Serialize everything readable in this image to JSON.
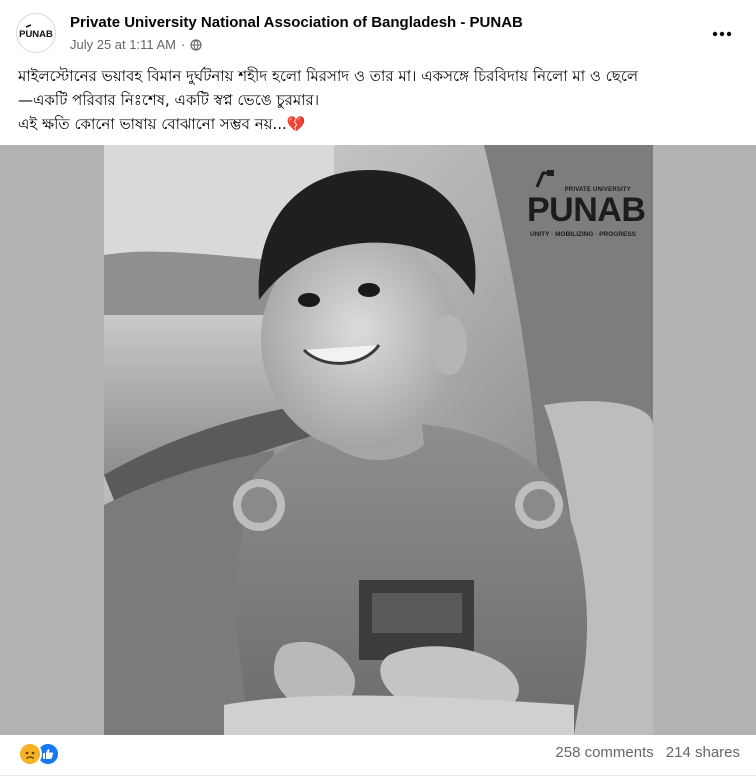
{
  "post": {
    "page_name": "Private University National Association of Bangladesh - PUNAB",
    "timestamp": "July 25 at 1:11 AM",
    "separator": "·",
    "privacy_icon": "globe-icon",
    "avatar_text": "PUNAB",
    "text_lines": [
      "মাইলস্টোনের ভয়াবহ বিমান দুর্ঘটনায় শহীদ হলো মিরসাদ ও তার মা। একসঙ্গে চিরবিদায় নিলো মা ও ছেলে",
      "—একটি পরিবার নিঃশেষ, একটি স্বপ্ন ভেঙে চুরমার।",
      "এই ক্ষতি কোনো ভাষায় বোঝানো সম্ভব নয়...💔"
    ]
  },
  "photo": {
    "watermark_small": "PRIVATE UNIVERSITY",
    "watermark_main": "PUNAB",
    "watermark_tagline": "UNITY · MOBILIZING · PROGRESS"
  },
  "footer": {
    "reaction_icons": [
      "sad-emoji-icon",
      "like-icon"
    ],
    "comments": "258 comments",
    "shares": "214 shares"
  },
  "colors": {
    "text_primary": "#050505",
    "text_secondary": "#65676b",
    "like_blue": "#1877f2",
    "sad_yellow": "#f7b125",
    "photo_side_bg": "#b5b2b6"
  }
}
